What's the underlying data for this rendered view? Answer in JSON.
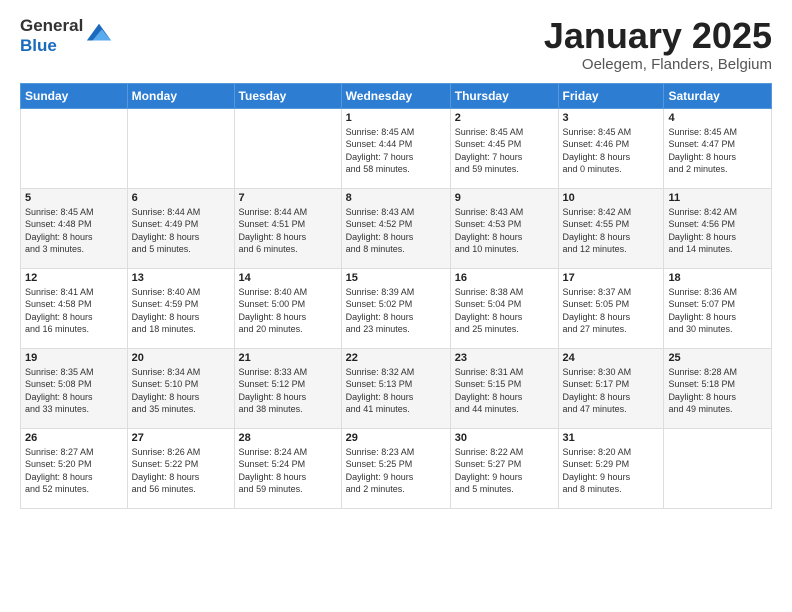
{
  "logo": {
    "general": "General",
    "blue": "Blue"
  },
  "title": "January 2025",
  "location": "Oelegem, Flanders, Belgium",
  "weekdays": [
    "Sunday",
    "Monday",
    "Tuesday",
    "Wednesday",
    "Thursday",
    "Friday",
    "Saturday"
  ],
  "weeks": [
    [
      {
        "day": "",
        "info": ""
      },
      {
        "day": "",
        "info": ""
      },
      {
        "day": "",
        "info": ""
      },
      {
        "day": "1",
        "info": "Sunrise: 8:45 AM\nSunset: 4:44 PM\nDaylight: 7 hours\nand 58 minutes."
      },
      {
        "day": "2",
        "info": "Sunrise: 8:45 AM\nSunset: 4:45 PM\nDaylight: 7 hours\nand 59 minutes."
      },
      {
        "day": "3",
        "info": "Sunrise: 8:45 AM\nSunset: 4:46 PM\nDaylight: 8 hours\nand 0 minutes."
      },
      {
        "day": "4",
        "info": "Sunrise: 8:45 AM\nSunset: 4:47 PM\nDaylight: 8 hours\nand 2 minutes."
      }
    ],
    [
      {
        "day": "5",
        "info": "Sunrise: 8:45 AM\nSunset: 4:48 PM\nDaylight: 8 hours\nand 3 minutes."
      },
      {
        "day": "6",
        "info": "Sunrise: 8:44 AM\nSunset: 4:49 PM\nDaylight: 8 hours\nand 5 minutes."
      },
      {
        "day": "7",
        "info": "Sunrise: 8:44 AM\nSunset: 4:51 PM\nDaylight: 8 hours\nand 6 minutes."
      },
      {
        "day": "8",
        "info": "Sunrise: 8:43 AM\nSunset: 4:52 PM\nDaylight: 8 hours\nand 8 minutes."
      },
      {
        "day": "9",
        "info": "Sunrise: 8:43 AM\nSunset: 4:53 PM\nDaylight: 8 hours\nand 10 minutes."
      },
      {
        "day": "10",
        "info": "Sunrise: 8:42 AM\nSunset: 4:55 PM\nDaylight: 8 hours\nand 12 minutes."
      },
      {
        "day": "11",
        "info": "Sunrise: 8:42 AM\nSunset: 4:56 PM\nDaylight: 8 hours\nand 14 minutes."
      }
    ],
    [
      {
        "day": "12",
        "info": "Sunrise: 8:41 AM\nSunset: 4:58 PM\nDaylight: 8 hours\nand 16 minutes."
      },
      {
        "day": "13",
        "info": "Sunrise: 8:40 AM\nSunset: 4:59 PM\nDaylight: 8 hours\nand 18 minutes."
      },
      {
        "day": "14",
        "info": "Sunrise: 8:40 AM\nSunset: 5:00 PM\nDaylight: 8 hours\nand 20 minutes."
      },
      {
        "day": "15",
        "info": "Sunrise: 8:39 AM\nSunset: 5:02 PM\nDaylight: 8 hours\nand 23 minutes."
      },
      {
        "day": "16",
        "info": "Sunrise: 8:38 AM\nSunset: 5:04 PM\nDaylight: 8 hours\nand 25 minutes."
      },
      {
        "day": "17",
        "info": "Sunrise: 8:37 AM\nSunset: 5:05 PM\nDaylight: 8 hours\nand 27 minutes."
      },
      {
        "day": "18",
        "info": "Sunrise: 8:36 AM\nSunset: 5:07 PM\nDaylight: 8 hours\nand 30 minutes."
      }
    ],
    [
      {
        "day": "19",
        "info": "Sunrise: 8:35 AM\nSunset: 5:08 PM\nDaylight: 8 hours\nand 33 minutes."
      },
      {
        "day": "20",
        "info": "Sunrise: 8:34 AM\nSunset: 5:10 PM\nDaylight: 8 hours\nand 35 minutes."
      },
      {
        "day": "21",
        "info": "Sunrise: 8:33 AM\nSunset: 5:12 PM\nDaylight: 8 hours\nand 38 minutes."
      },
      {
        "day": "22",
        "info": "Sunrise: 8:32 AM\nSunset: 5:13 PM\nDaylight: 8 hours\nand 41 minutes."
      },
      {
        "day": "23",
        "info": "Sunrise: 8:31 AM\nSunset: 5:15 PM\nDaylight: 8 hours\nand 44 minutes."
      },
      {
        "day": "24",
        "info": "Sunrise: 8:30 AM\nSunset: 5:17 PM\nDaylight: 8 hours\nand 47 minutes."
      },
      {
        "day": "25",
        "info": "Sunrise: 8:28 AM\nSunset: 5:18 PM\nDaylight: 8 hours\nand 49 minutes."
      }
    ],
    [
      {
        "day": "26",
        "info": "Sunrise: 8:27 AM\nSunset: 5:20 PM\nDaylight: 8 hours\nand 52 minutes."
      },
      {
        "day": "27",
        "info": "Sunrise: 8:26 AM\nSunset: 5:22 PM\nDaylight: 8 hours\nand 56 minutes."
      },
      {
        "day": "28",
        "info": "Sunrise: 8:24 AM\nSunset: 5:24 PM\nDaylight: 8 hours\nand 59 minutes."
      },
      {
        "day": "29",
        "info": "Sunrise: 8:23 AM\nSunset: 5:25 PM\nDaylight: 9 hours\nand 2 minutes."
      },
      {
        "day": "30",
        "info": "Sunrise: 8:22 AM\nSunset: 5:27 PM\nDaylight: 9 hours\nand 5 minutes."
      },
      {
        "day": "31",
        "info": "Sunrise: 8:20 AM\nSunset: 5:29 PM\nDaylight: 9 hours\nand 8 minutes."
      },
      {
        "day": "",
        "info": ""
      }
    ]
  ]
}
